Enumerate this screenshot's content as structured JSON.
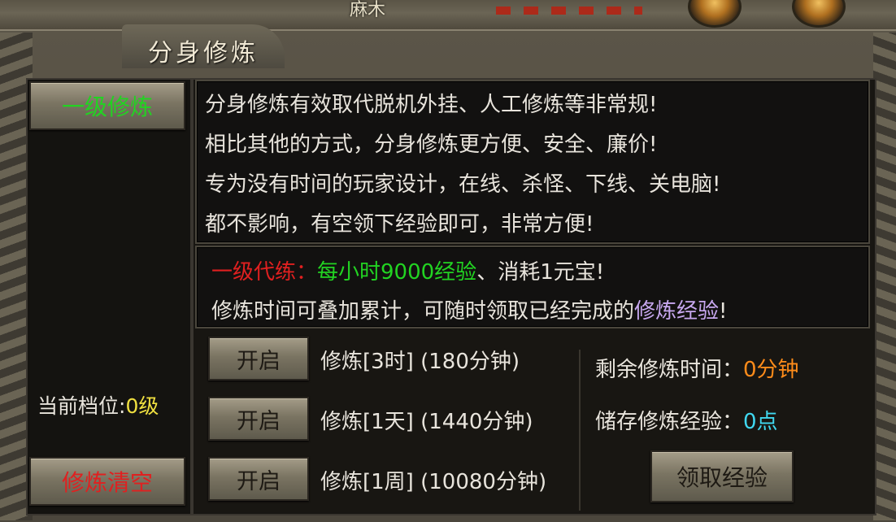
{
  "scenery": {
    "name_text": "麻木"
  },
  "window": {
    "title": "分身修炼"
  },
  "sidebar": {
    "level_button": "一级修炼",
    "current_level_label": "当前档位:",
    "current_level_value": "0级",
    "clear_button": "修炼清空"
  },
  "description": {
    "lines": [
      "分身修炼有效取代脱机外挂、人工修炼等非常规!",
      "相比其他的方式，分身修炼更方便、安全、廉价!",
      "专为没有时间的玩家设计，在线、杀怪、下线、关电脑!",
      "都不影响，有空领下经验即可，非常方便!"
    ]
  },
  "tier_info": {
    "name": "一级代练：",
    "rate": "每小时9000经验",
    "sep": "、",
    "cost": "消耗1元宝!",
    "note_prefix": "修炼时间可叠加累计，可随时领取已经完成的",
    "note_highlight": "修炼经验",
    "note_suffix": "!"
  },
  "options": [
    {
      "button": "开启",
      "label": "修炼[3时] (180分钟)"
    },
    {
      "button": "开启",
      "label": "修炼[1天] (1440分钟)"
    },
    {
      "button": "开启",
      "label": "修炼[1周] (10080分钟)"
    }
  ],
  "status": {
    "remaining_label": "剩余修炼时间：",
    "remaining_value": "0分钟",
    "stored_label": "储存修炼经验：",
    "stored_value": "0点",
    "claim_button": "领取经验"
  },
  "colors": {
    "green": "#22d322",
    "red": "#e02020",
    "yellow": "#f0e040",
    "orange": "#ff8c1a",
    "cyan": "#40d8f0",
    "purple": "#c8a8f0"
  }
}
